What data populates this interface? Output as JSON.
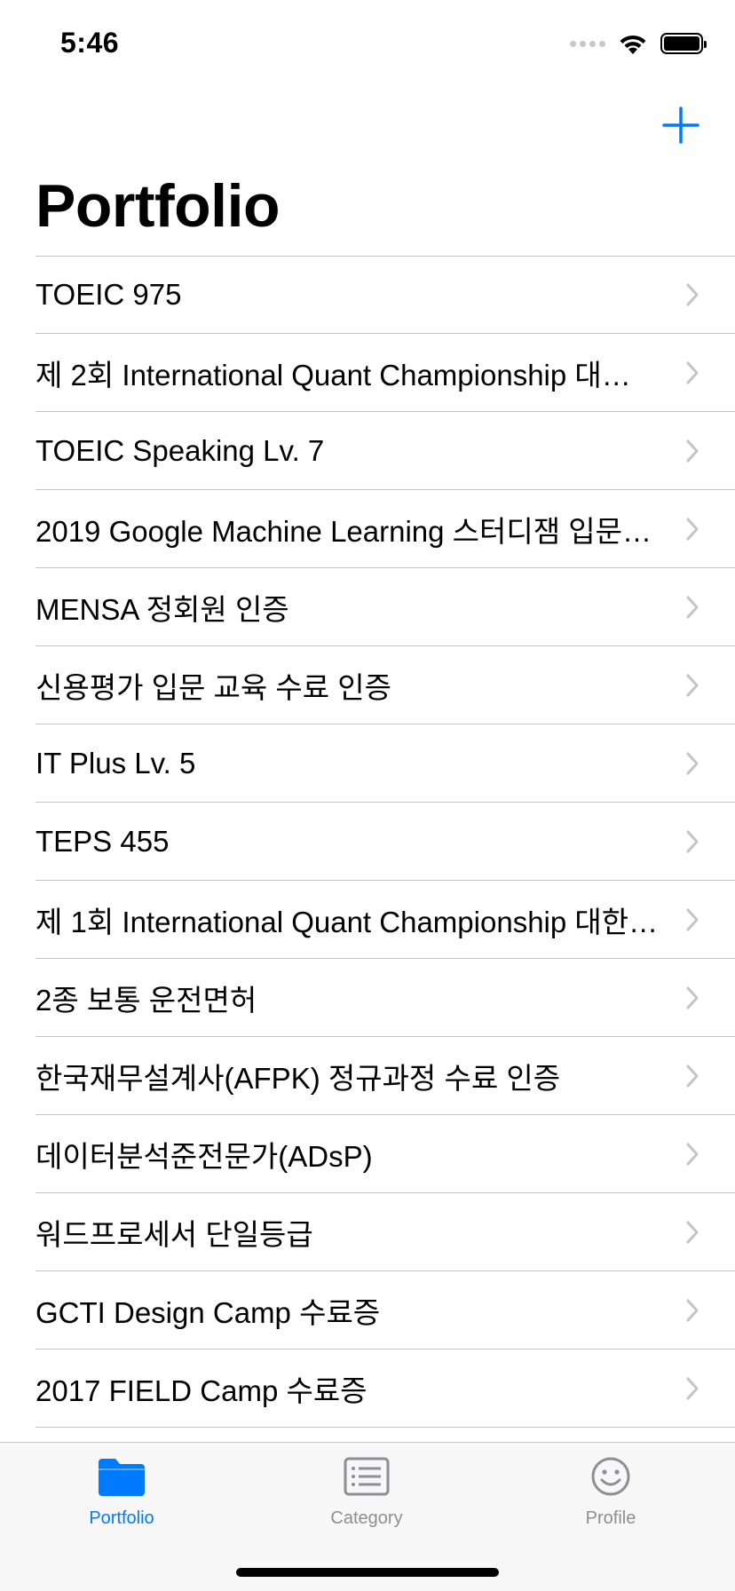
{
  "status_bar": {
    "time": "5:46"
  },
  "header": {
    "title": "Portfolio"
  },
  "portfolio_items": [
    {
      "label": "TOEIC 975"
    },
    {
      "label": "제 2회 International Quant Championship 대…"
    },
    {
      "label": "TOEIC Speaking Lv. 7"
    },
    {
      "label": "2019 Google Machine Learning 스터디잼 입문…"
    },
    {
      "label": "MENSA 정회원 인증"
    },
    {
      "label": "신용평가 입문 교육 수료 인증"
    },
    {
      "label": "IT Plus Lv. 5"
    },
    {
      "label": "TEPS 455"
    },
    {
      "label": "제 1회 International Quant Championship 대한…"
    },
    {
      "label": "2종 보통 운전면허"
    },
    {
      "label": "한국재무설계사(AFPK) 정규과정 수료 인증"
    },
    {
      "label": "데이터분석준전문가(ADsP)"
    },
    {
      "label": "워드프로세서 단일등급"
    },
    {
      "label": "GCTI Design Camp 수료증"
    },
    {
      "label": "2017 FIELD Camp 수료증"
    }
  ],
  "tab_bar": {
    "tabs": [
      {
        "label": "Portfolio",
        "icon": "folder-icon",
        "active": true
      },
      {
        "label": "Category",
        "icon": "list-icon",
        "active": false
      },
      {
        "label": "Profile",
        "icon": "smiley-icon",
        "active": false
      }
    ]
  },
  "colors": {
    "accent": "#007aff",
    "inactive": "#8e8e93",
    "separator": "#c6c6c8",
    "chevron": "#c4c4c7"
  }
}
